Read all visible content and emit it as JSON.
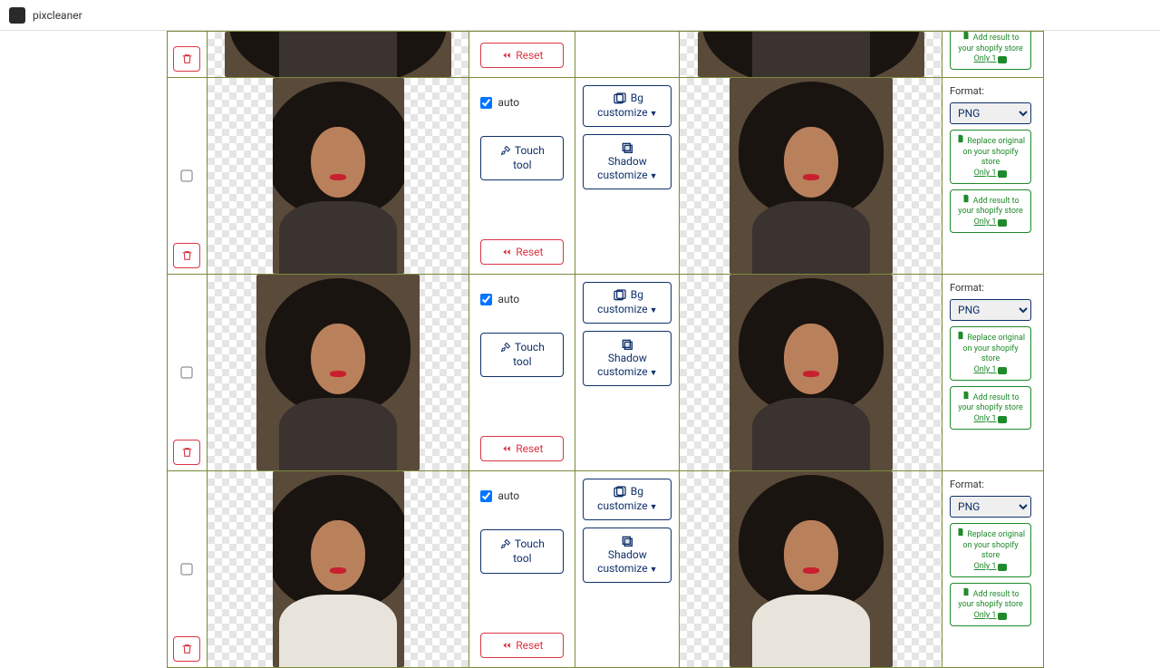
{
  "app": {
    "name": "pixcleaner"
  },
  "labels": {
    "auto": "auto",
    "touch_tool": "Touch tool",
    "reset": "Reset",
    "bg_customize": "Bg customize",
    "shadow_customize": "Shadow customize",
    "format": "Format:",
    "format_value": "PNG",
    "replace_original": "Replace original on your shopify store",
    "add_result": "Add result to your shopify store",
    "only1": "Only 1"
  },
  "rows": [
    {
      "partial": true
    },
    {
      "partial": false
    },
    {
      "partial": false
    },
    {
      "partial": false
    }
  ]
}
